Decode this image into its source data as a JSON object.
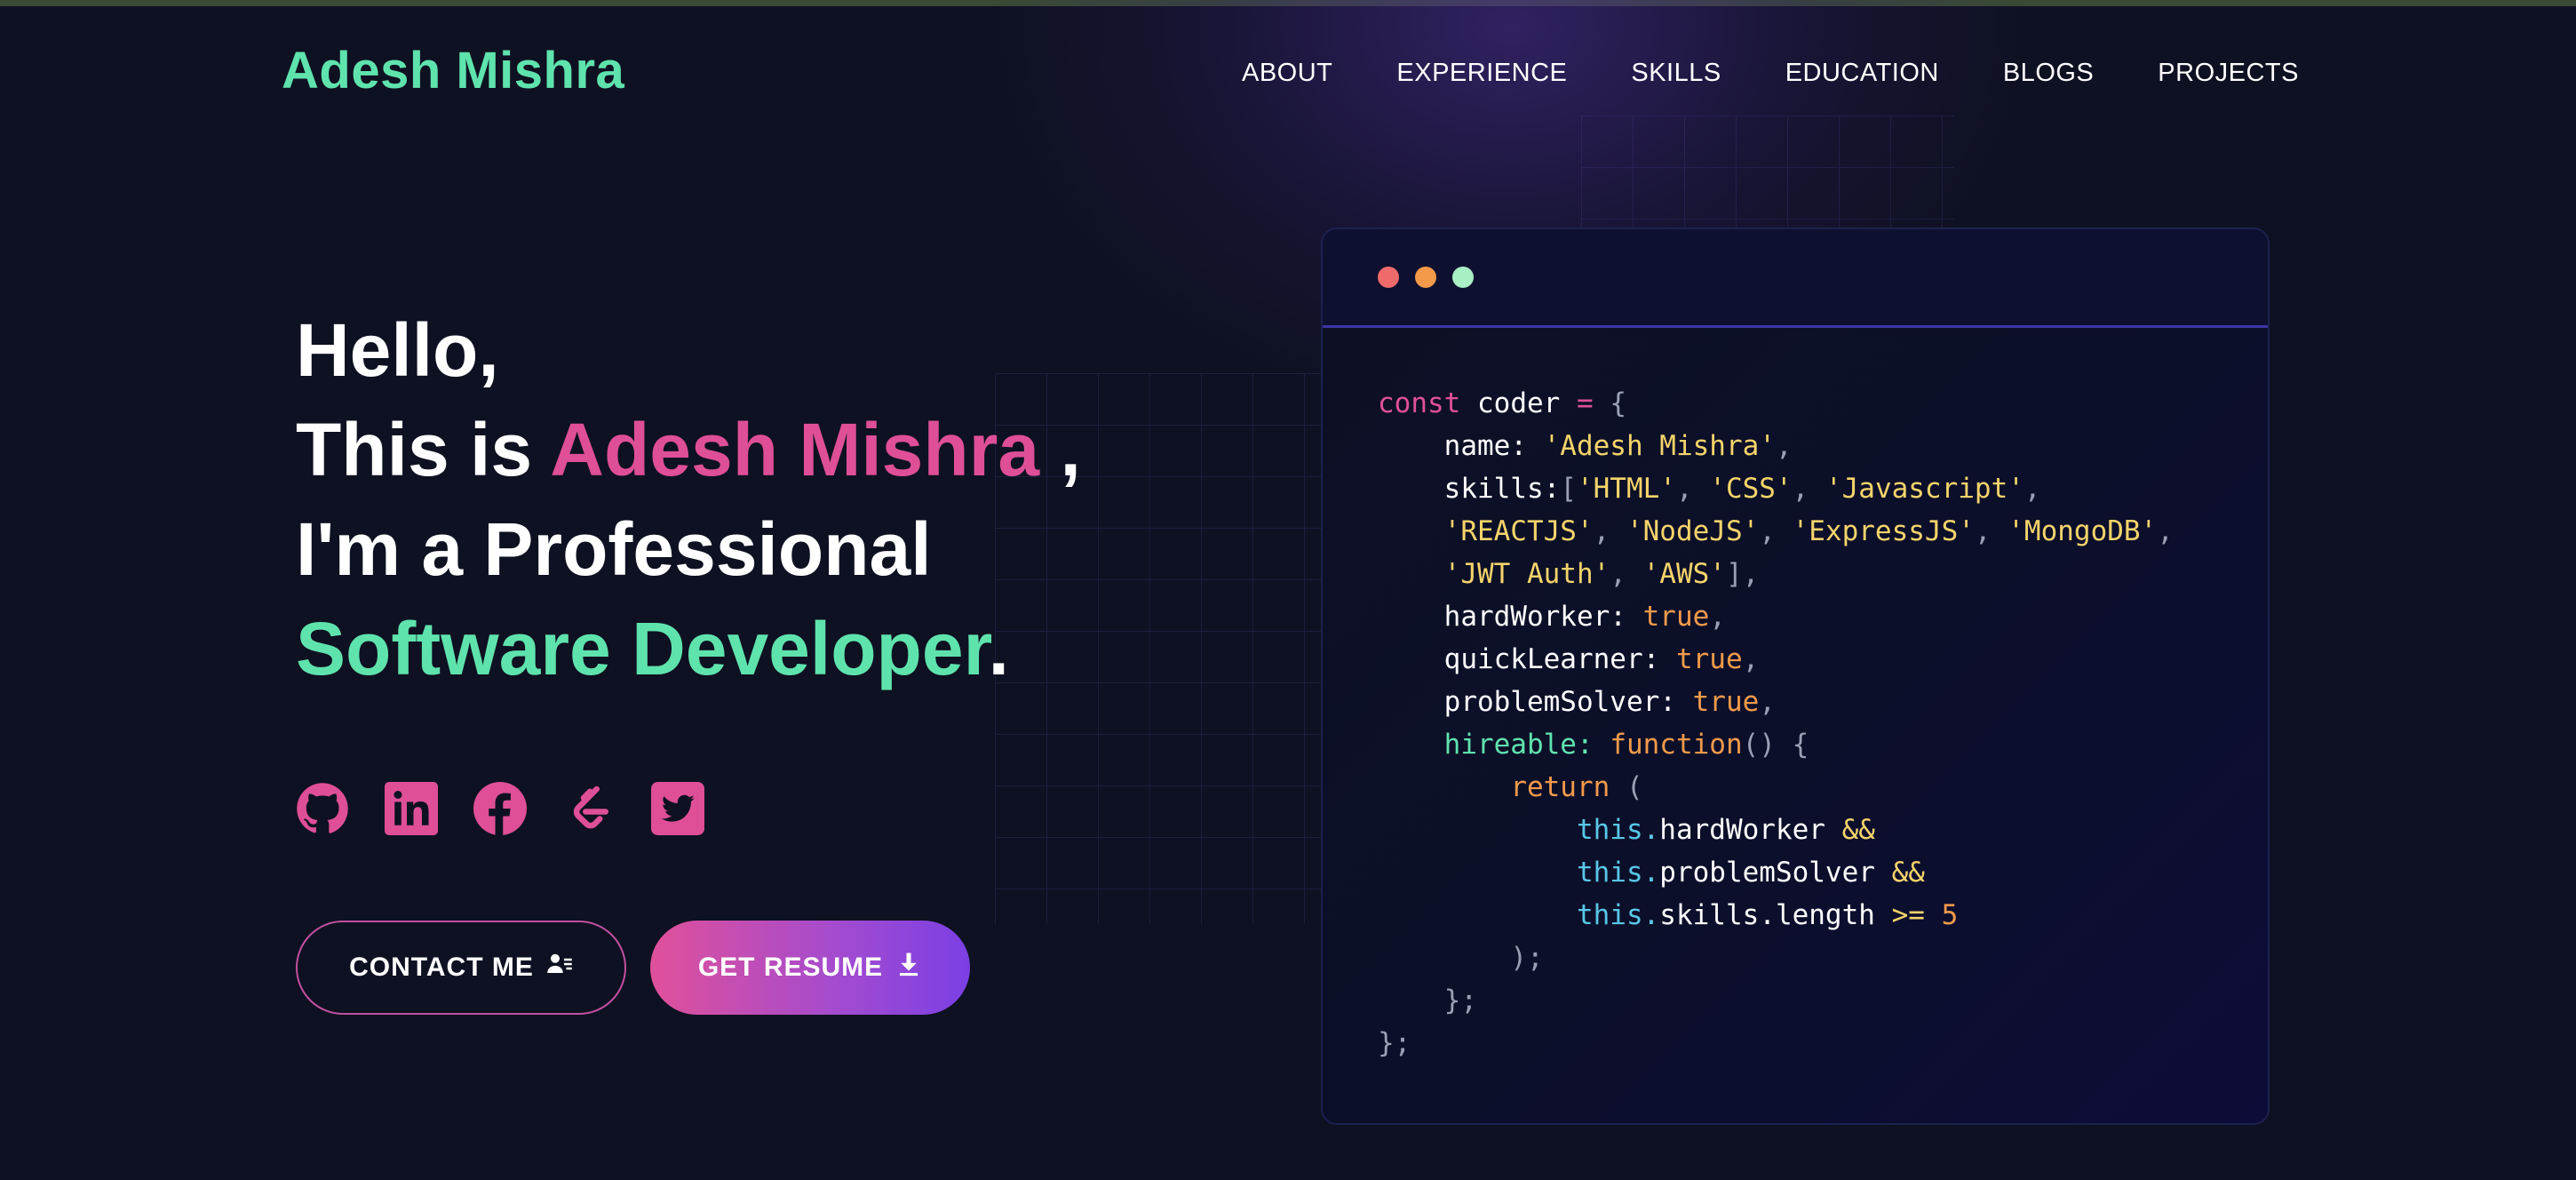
{
  "header": {
    "logo": "Adesh Mishra",
    "nav": [
      "ABOUT",
      "EXPERIENCE",
      "SKILLS",
      "EDUCATION",
      "BLOGS",
      "PROJECTS"
    ]
  },
  "hero": {
    "line1": "Hello,",
    "line2_prefix": "This is ",
    "line2_name": "Adesh Mishra",
    "line2_suffix": " ,",
    "line3": "I'm a Professional",
    "line4_role": "Software Developer",
    "line4_suffix": "."
  },
  "socials": [
    {
      "icon": "github-icon"
    },
    {
      "icon": "linkedin-icon"
    },
    {
      "icon": "facebook-icon"
    },
    {
      "icon": "leetcode-icon"
    },
    {
      "icon": "twitter-icon"
    }
  ],
  "buttons": {
    "contact": "CONTACT ME",
    "resume": "GET RESUME"
  },
  "colors": {
    "background": "#0e1121",
    "green": "#5fe3ad",
    "pink": "#de4f97",
    "purple": "#7b3fe4"
  },
  "code": {
    "const_kw": "const",
    "var_name": "coder",
    "name_key": "name",
    "name_val": "'Adesh Mishra'",
    "skills_key": "skills",
    "skills": [
      "'HTML'",
      "'CSS'",
      "'Javascript'",
      "'REACTJS'",
      "'NodeJS'",
      "'ExpressJS'",
      "'MongoDB'",
      "'JWT Auth'",
      "'AWS'"
    ],
    "hardWorker_key": "hardWorker",
    "quickLearner_key": "quickLearner",
    "problemSolver_key": "problemSolver",
    "true_val": "true",
    "hireable_key": "hireable:",
    "function_kw": "function",
    "return_kw": "return",
    "this_kw": "this.",
    "hw_prop": "hardWorker",
    "ps_prop": "problemSolver",
    "skills_prop": "skills.length",
    "and_op": "&&",
    "gte_op": ">=",
    "num": "5"
  }
}
